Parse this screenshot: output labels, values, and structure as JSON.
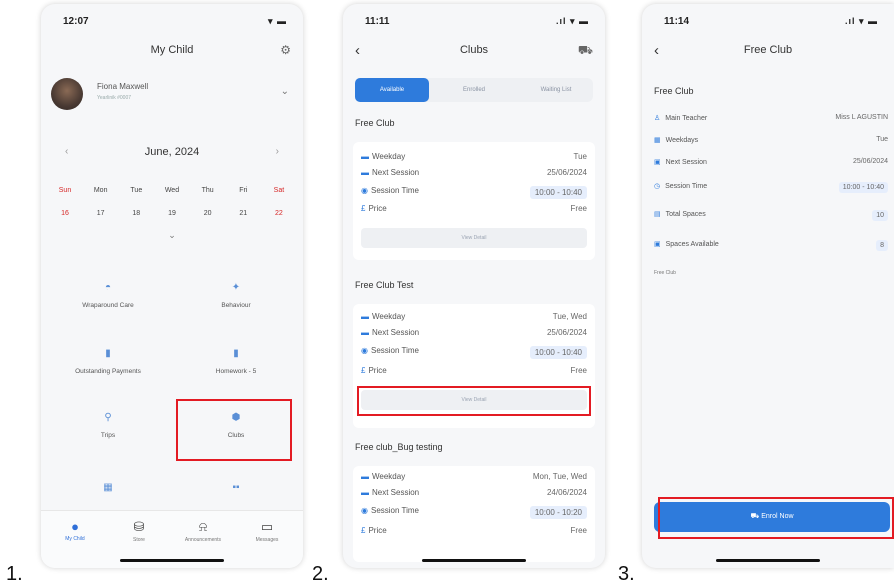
{
  "steps": [
    "1.",
    "2.",
    "3."
  ],
  "screen1": {
    "time": "12:07",
    "title": "My Child",
    "child_name": "Fiona Maxwell",
    "child_id": "Yearlinik #0007",
    "month": "June, 2024",
    "weekdays": [
      "Sun",
      "Mon",
      "Tue",
      "Wed",
      "Thu",
      "Fri",
      "Sat"
    ],
    "dates": [
      "16",
      "17",
      "18",
      "19",
      "20",
      "21",
      "22"
    ],
    "tiles": [
      "Wraparound Care",
      "Behaviour",
      "Outstanding Payments",
      "Homework - 5",
      "Trips",
      "Clubs"
    ],
    "tabs": [
      "My Child",
      "Store",
      "Announcements",
      "Messages"
    ]
  },
  "screen2": {
    "time": "11:11",
    "title": "Clubs",
    "segments": [
      "Available",
      "Enrolled",
      "Waiting List"
    ],
    "labels": {
      "weekday": "Weekday",
      "next_session": "Next Session",
      "session_time": "Session Time",
      "price": "Price",
      "view_detail": "View Detail"
    },
    "clubs": [
      {
        "name": "Free Club",
        "weekday": "Tue",
        "next_session": "25/06/2024",
        "session_time": "10:00 - 10:40",
        "price": "Free"
      },
      {
        "name": "Free Club Test",
        "weekday": "Tue, Wed",
        "next_session": "25/06/2024",
        "session_time": "10:00 - 10:40",
        "price": "Free"
      },
      {
        "name": "Free club_Bug testing",
        "weekday": "Mon, Tue, Wed",
        "next_session": "24/06/2024",
        "session_time": "10:00 - 10:20",
        "price": "Free"
      }
    ]
  },
  "screen3": {
    "time": "11:14",
    "title": "Free Club",
    "club_name": "Free Club",
    "rows": [
      {
        "label": "Main Teacher",
        "value": "Miss L AGUSTIN"
      },
      {
        "label": "Weekdays",
        "value": "Tue"
      },
      {
        "label": "Next Session",
        "value": "25/06/2024"
      },
      {
        "label": "Session Time",
        "value": "10:00 - 10:40"
      },
      {
        "label": "Total Spaces",
        "value": "10"
      },
      {
        "label": "Spaces Available",
        "value": "8"
      }
    ],
    "description": "Free Club",
    "enrol_button": "Enrol Now"
  },
  "colors": {
    "accent": "#2e7bdc",
    "highlight": "#e31b23",
    "weekend": "#d62828"
  }
}
